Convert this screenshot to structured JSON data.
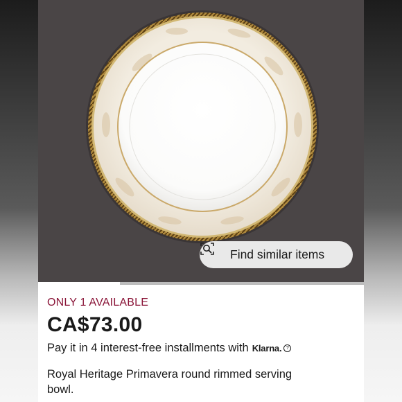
{
  "listing": {
    "image_alt_icon": "serving-bowl-photo",
    "find_similar_label": "Find similar items",
    "find_similar_icon": "visual-search-icon",
    "image_carousel_position": 0.25,
    "availability": "ONLY 1 AVAILABLE",
    "price": "CA$73.00",
    "installments_text": "Pay it in 4 interest-free installments with",
    "klarna_label": "Klarna.",
    "info_icon": "info-icon",
    "description": "Royal Heritage Primavera round rimmed serving bowl."
  },
  "colors": {
    "availability": "#8a1538",
    "image_background": "#4a4546"
  }
}
